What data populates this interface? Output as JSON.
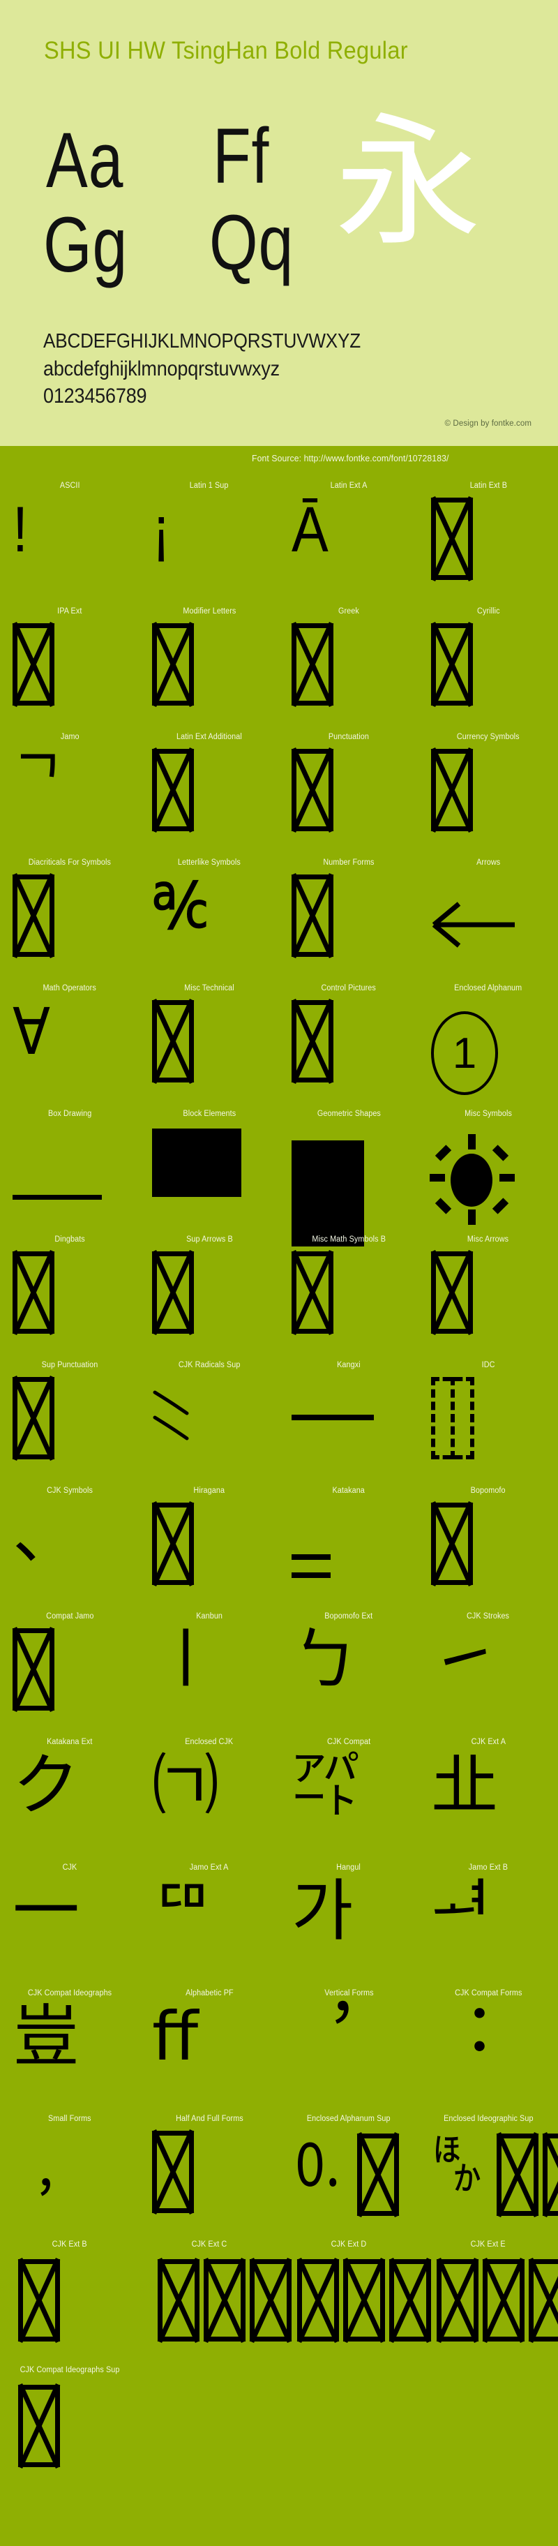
{
  "header": {
    "font_title": "SHS UI HW TsingHan Bold Regular",
    "samples": {
      "pair_1": "Aa",
      "pair_2": "Ff",
      "pair_3": "Gg",
      "pair_4": "Qq",
      "cjk_sample": "永"
    },
    "alphabet_uppercase": "ABCDEFGHIJKLMNOPQRSTUVWXYZ",
    "alphabet_lowercase": "abcdefghijklmnopqrstuvwxyz",
    "digits": "0123456789",
    "copyright": "© Design by fontke.com"
  },
  "source_bar": {
    "font_source": "Font Source: http://www.fontke.com/font/10728183/"
  },
  "colors": {
    "header_background": "#dde89a",
    "grid_background": "#8faf03",
    "title_color": "#8faf03",
    "label_color": "#f3f7e4",
    "glyph_color": "#000000",
    "cjk_sample_color": "#ffffff",
    "copyright_color": "#5d6b42"
  },
  "unicode_blocks": [
    [
      {
        "label": "ASCII",
        "glyph": "!",
        "kind": "text"
      },
      {
        "label": "Latin 1 Sup",
        "glyph": "¡",
        "kind": "text"
      },
      {
        "label": "Latin Ext A",
        "glyph": "Ā",
        "kind": "text"
      },
      {
        "label": "Latin Ext B",
        "glyph": "",
        "kind": "tofu"
      }
    ],
    [
      {
        "label": "IPA Ext",
        "glyph": "",
        "kind": "tofu"
      },
      {
        "label": "Modifier Letters",
        "glyph": "",
        "kind": "tofu"
      },
      {
        "label": "Greek",
        "glyph": "",
        "kind": "tofu"
      },
      {
        "label": "Cyrillic",
        "glyph": "",
        "kind": "tofu"
      }
    ],
    [
      {
        "label": "Jamo",
        "glyph": "ᄀ",
        "kind": "text"
      },
      {
        "label": "Latin Ext Additional",
        "glyph": "",
        "kind": "tofu"
      },
      {
        "label": "Punctuation",
        "glyph": "",
        "kind": "tofu"
      },
      {
        "label": "Currency Symbols",
        "glyph": "",
        "kind": "tofu"
      }
    ],
    [
      {
        "label": "Diacriticals For Symbols",
        "glyph": "",
        "kind": "tofu"
      },
      {
        "label": "Letterlike Symbols",
        "glyph": "℀",
        "kind": "text"
      },
      {
        "label": "Number Forms",
        "glyph": "",
        "kind": "tofu"
      },
      {
        "label": "Arrows",
        "glyph": "←",
        "kind": "arrow-left"
      }
    ],
    [
      {
        "label": "Math Operators",
        "glyph": "∀",
        "kind": "text"
      },
      {
        "label": "Misc Technical",
        "glyph": "",
        "kind": "tofu"
      },
      {
        "label": "Control Pictures",
        "glyph": "",
        "kind": "tofu"
      },
      {
        "label": "Enclosed Alphanum",
        "glyph": "①",
        "kind": "circled-one"
      }
    ],
    [
      {
        "label": "Box Drawing",
        "glyph": "─",
        "kind": "box-line"
      },
      {
        "label": "Block Elements",
        "glyph": "█",
        "kind": "block-solid"
      },
      {
        "label": "Geometric Shapes",
        "glyph": "■",
        "kind": "geo-solid"
      },
      {
        "label": "Misc Symbols",
        "glyph": "☀",
        "kind": "sun"
      }
    ],
    [
      {
        "label": "Dingbats",
        "glyph": "",
        "kind": "tofu"
      },
      {
        "label": "Sup Arrows B",
        "glyph": "",
        "kind": "tofu"
      },
      {
        "label": "Misc Math Symbols B",
        "glyph": "",
        "kind": "tofu"
      },
      {
        "label": "Misc Arrows",
        "glyph": "",
        "kind": "tofu"
      }
    ],
    [
      {
        "label": "Sup Punctuation",
        "glyph": "",
        "kind": "tofu"
      },
      {
        "label": "CJK Radicals Sup",
        "glyph": "⺀",
        "kind": "strokes"
      },
      {
        "label": "Kangxi",
        "glyph": "⼀",
        "kind": "kangxi-line"
      },
      {
        "label": "IDC",
        "glyph": "⿰",
        "kind": "idc-dashed"
      }
    ],
    [
      {
        "label": "CJK Symbols",
        "glyph": "、",
        "kind": "text"
      },
      {
        "label": "Hiragana",
        "glyph": "",
        "kind": "tofu"
      },
      {
        "label": "Katakana",
        "glyph": "゠",
        "kind": "katakana-eq"
      },
      {
        "label": "Bopomofo",
        "glyph": "",
        "kind": "tofu"
      }
    ],
    [
      {
        "label": "Compat Jamo",
        "glyph": "",
        "kind": "tofu"
      },
      {
        "label": "Kanbun",
        "glyph": "㇑",
        "kind": "text"
      },
      {
        "label": "Bopomofo Ext",
        "glyph": "ㄅ",
        "kind": "text"
      },
      {
        "label": "CJK Strokes",
        "glyph": "㇀",
        "kind": "text"
      }
    ],
    [
      {
        "label": "Katakana Ext",
        "glyph": "ク",
        "kind": "text"
      },
      {
        "label": "Enclosed CJK",
        "glyph": "㈀",
        "kind": "text"
      },
      {
        "label": "CJK Compat",
        "glyph": "㌀",
        "kind": "text"
      },
      {
        "label": "CJK Ext A",
        "glyph": "㐀",
        "kind": "text"
      }
    ],
    [
      {
        "label": "CJK",
        "glyph": "一",
        "kind": "text"
      },
      {
        "label": "Jamo Ext A",
        "glyph": "ꥠ",
        "kind": "text"
      },
      {
        "label": "Hangul",
        "glyph": "가",
        "kind": "text"
      },
      {
        "label": "Jamo Ext B",
        "glyph": "ힰ",
        "kind": "text"
      }
    ],
    [
      {
        "label": "CJK Compat Ideographs",
        "glyph": "豈",
        "kind": "text"
      },
      {
        "label": "Alphabetic PF",
        "glyph": "ﬀ",
        "kind": "text"
      },
      {
        "label": "Vertical Forms",
        "glyph": "︐",
        "kind": "text"
      },
      {
        "label": "CJK Compat Forms",
        "glyph": "︓",
        "kind": "text"
      }
    ],
    [
      {
        "label": "Small Forms",
        "glyph": "﹐",
        "kind": "text"
      },
      {
        "label": "Half And Full Forms",
        "glyph": "",
        "kind": "tofu"
      },
      {
        "label": "Enclosed Alphanum Sup",
        "glyph": "🄀",
        "kind": "tofu-overflow-1"
      },
      {
        "label": "Enclosed Ideographic Sup",
        "glyph": "🈀",
        "kind": "tofu-overflow-4"
      }
    ],
    [
      {
        "label": "CJK Ext B",
        "glyph": "𠀀",
        "kind": "tofu-overflow-1"
      },
      {
        "label": "CJK Ext C",
        "glyph": "𪜀",
        "kind": "tofu-overflow-3"
      },
      {
        "label": "CJK Ext D",
        "glyph": "𫝀",
        "kind": "tofu-overflow-3"
      },
      {
        "label": "CJK Ext E",
        "glyph": "𫞀",
        "kind": "tofu-overflow-3"
      }
    ],
    [
      {
        "label": "CJK Compat Ideographs Sup",
        "glyph": "𪜀",
        "kind": "tofu-overflow-1"
      }
    ]
  ]
}
